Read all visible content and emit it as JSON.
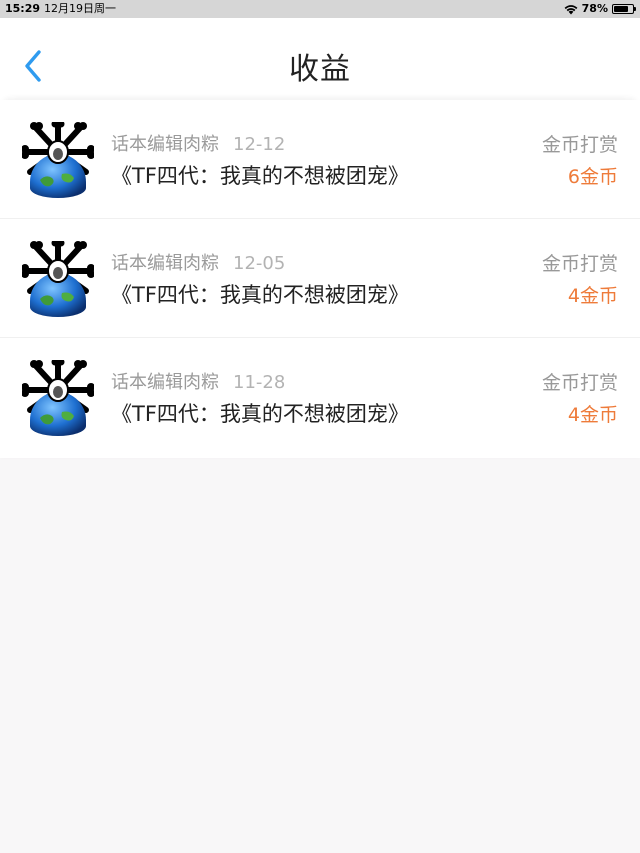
{
  "status_bar": {
    "time": "15:29",
    "date": "12月19日周一",
    "battery_text": "78%",
    "battery_level": 0.78,
    "wifi_icon": "wifi-icon"
  },
  "nav": {
    "title": "收益",
    "back_icon": "chevron-left-icon"
  },
  "colors": {
    "accent": "#2f9bef",
    "amount": "#ee7b3a"
  },
  "records": [
    {
      "author": "话本编辑肉粽",
      "date": "12-12",
      "title": "《TF四代：我真的不想被团宠》",
      "type": "金币打赏",
      "amount": "6金币"
    },
    {
      "author": "话本编辑肉粽",
      "date": "12-05",
      "title": "《TF四代：我真的不想被团宠》",
      "type": "金币打赏",
      "amount": "4金币"
    },
    {
      "author": "话本编辑肉粽",
      "date": "11-28",
      "title": "《TF四代：我真的不想被团宠》",
      "type": "金币打赏",
      "amount": "4金币"
    }
  ]
}
